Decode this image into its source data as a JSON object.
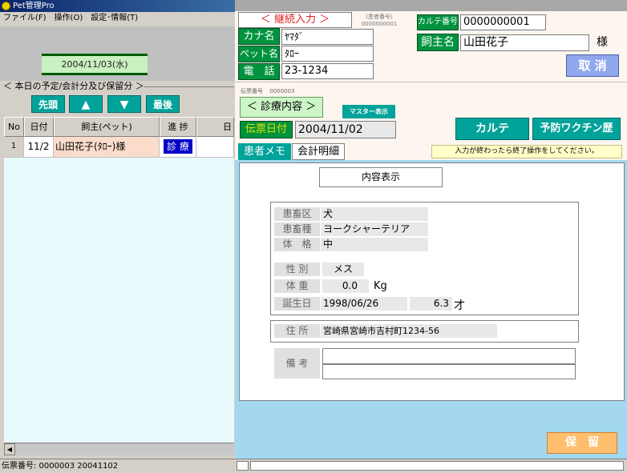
{
  "left": {
    "title": "Pet管理Pro",
    "menu": [
      "ファイル(F)",
      "操作(O)",
      "設定･情報(T)"
    ],
    "current_date": "2004/11/03(水)",
    "schedule_title": "＜ 本日の予定/会計分及び保留分 ＞",
    "nav": {
      "first": "先頭",
      "up": "▲",
      "down": "▼",
      "last": "最後"
    },
    "table": {
      "headers": [
        "No",
        "日付",
        "飼主(ペット)",
        "進 捗",
        "日"
      ],
      "rows": [
        {
          "no": "1",
          "date": "11/2",
          "owner": "山田花子(ﾀﾛｰ)様",
          "progress": "診 療"
        }
      ]
    },
    "status": "伝票番号: 0000003  20041102"
  },
  "right": {
    "continue_btn": "＜ 継続入力 ＞",
    "patient_no_label": "(患者番号)",
    "patient_no": "0000000001",
    "karte_no_label": "カルテ番号",
    "karte_no": "0000000001",
    "kana_label": "カナ名",
    "kana_value": "ﾔﾏﾀﾞ",
    "owner_label": "飼主名",
    "owner_value": "山田花子",
    "owner_suffix": "様",
    "pet_label": "ペット名",
    "pet_value": "ﾀﾛｰ",
    "phone_label": "電　話",
    "phone_value": "23-1234",
    "cancel_btn": "取 消",
    "slip_no_label": "伝票番号",
    "slip_no": "0000003",
    "treatment_btn": "＜ 診療内容 ＞",
    "master_btn": "マスター表示",
    "slip_date_label": "伝票日付",
    "slip_date": "2004/11/02",
    "karte_btn": "カルテ",
    "vaccine_btn": "予防ワクチン歴",
    "tabs": [
      "患者メモ",
      "会計明細"
    ],
    "notice": "入力が終わったら終了操作をしてください。",
    "content_display_btn": "内容表示",
    "memo": {
      "category_label": "患畜区",
      "category": "犬",
      "breed_label": "患畜種",
      "breed": "ヨークシャーテリア",
      "size_label": "体　格",
      "size": "中",
      "sex_label": "性 別",
      "sex": "メス",
      "weight_label": "体 重",
      "weight": "0.0",
      "weight_unit": "Kg",
      "birth_label": "誕生日",
      "birth": "1998/06/26",
      "age": "6.3",
      "age_unit": "才",
      "address_label": "住 所",
      "address": "宮崎県宮崎市吉村町1234-56",
      "remarks_label": "備 考"
    },
    "hold_btn": "保　留"
  }
}
